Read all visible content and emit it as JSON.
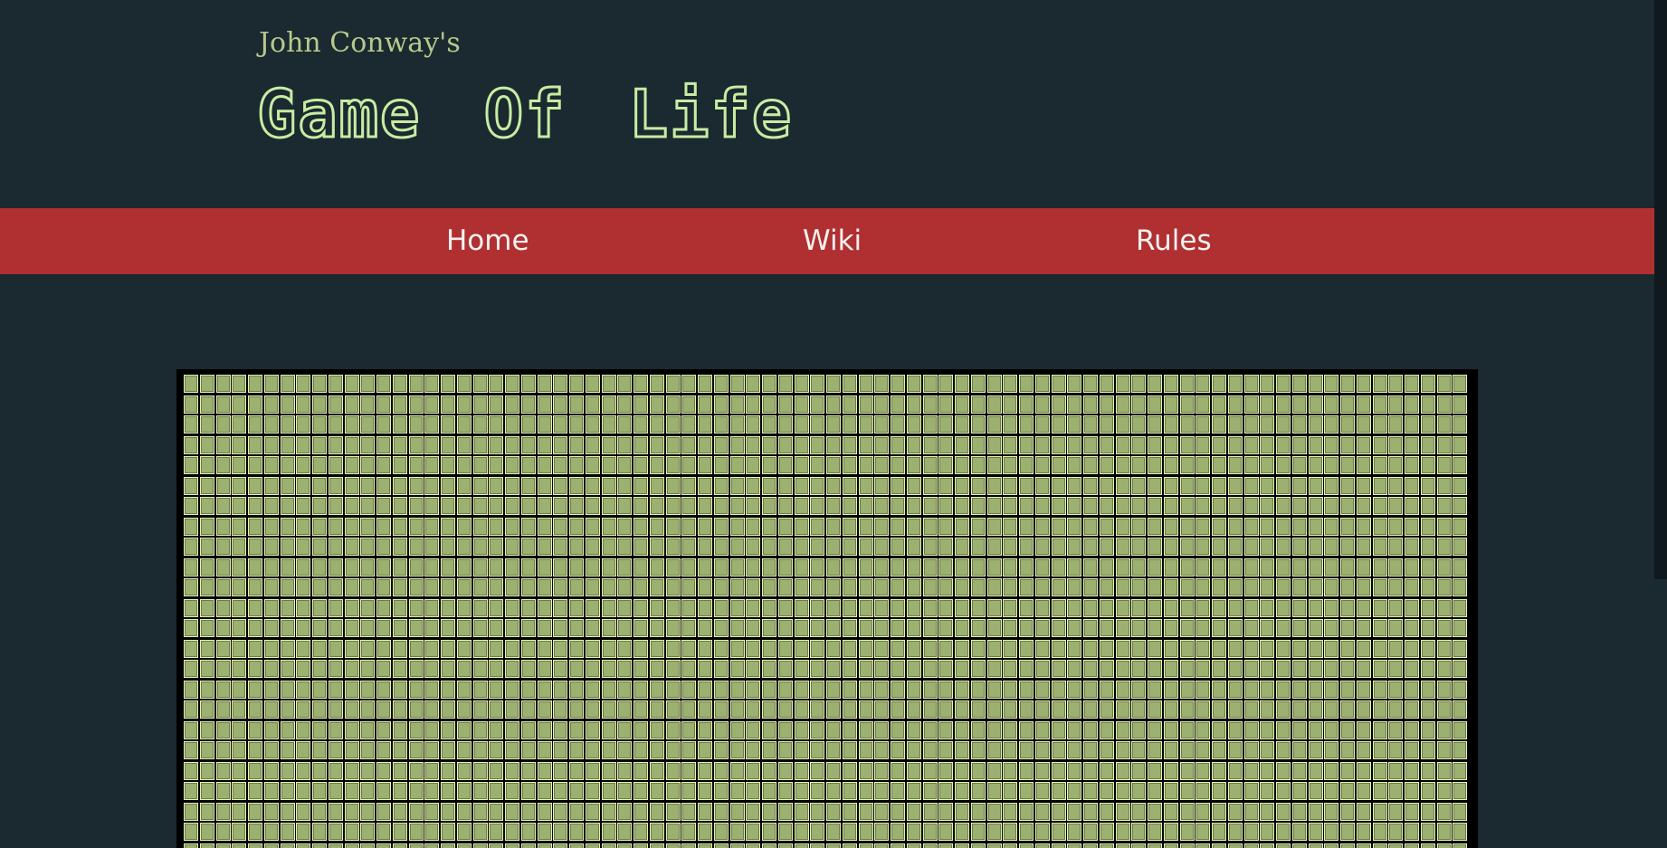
{
  "header": {
    "subtitle": "John Conway's",
    "title": "Game Of Life"
  },
  "nav": {
    "items": [
      {
        "label": "Home"
      },
      {
        "label": "Wiki"
      },
      {
        "label": "Rules"
      }
    ]
  },
  "board": {
    "columns": 80,
    "visible_rows": 24,
    "cell_state": "dead",
    "colors": {
      "cell_fill": "#9cb170",
      "cell_border": "#e7f2ba",
      "grid_lines": "#000000"
    }
  },
  "colors": {
    "background": "#1b2930",
    "nav_background": "#b03032",
    "title": "#c7eca2",
    "subtitle": "#b6c98d",
    "nav_text": "#f4f1ef"
  }
}
